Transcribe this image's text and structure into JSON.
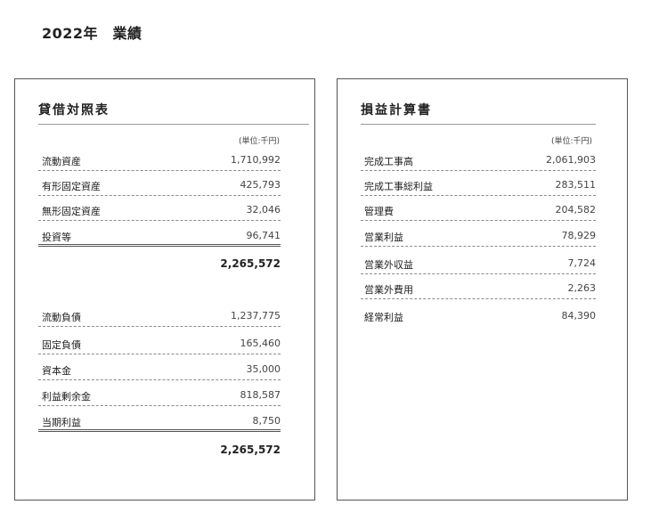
{
  "page_title": "2022年　業績",
  "balance_sheet": {
    "title": "貸借対照表",
    "unit": "(単位:千円)",
    "assets": [
      {
        "label": "流動資産",
        "value": "1,710,992"
      },
      {
        "label": "有形固定資産",
        "value": "425,793"
      },
      {
        "label": "無形固定資産",
        "value": "32,046"
      },
      {
        "label": "投資等",
        "value": "96,741"
      }
    ],
    "assets_total": "2,265,572",
    "liabilities": [
      {
        "label": "流動負債",
        "value": "1,237,775"
      },
      {
        "label": "固定負債",
        "value": "165,460"
      },
      {
        "label": "資本金",
        "value": "35,000"
      },
      {
        "label": "利益剰余金",
        "value": "818,587"
      },
      {
        "label": "当期利益",
        "value": "8,750"
      }
    ],
    "liabilities_total": "2,265,572"
  },
  "income_statement": {
    "title": "損益計算書",
    "unit": "(単位:千円)",
    "rows": [
      {
        "label": "完成工事高",
        "value": "2,061,903"
      },
      {
        "label": "完成工事総利益",
        "value": "283,511"
      },
      {
        "label": "管理費",
        "value": "204,582"
      },
      {
        "label": "営業利益",
        "value": "78,929"
      },
      {
        "label": "営業外収益",
        "value": "7,724"
      },
      {
        "label": "営業外費用",
        "value": "2,263"
      },
      {
        "label": "経常利益",
        "value": "84,390"
      }
    ]
  }
}
